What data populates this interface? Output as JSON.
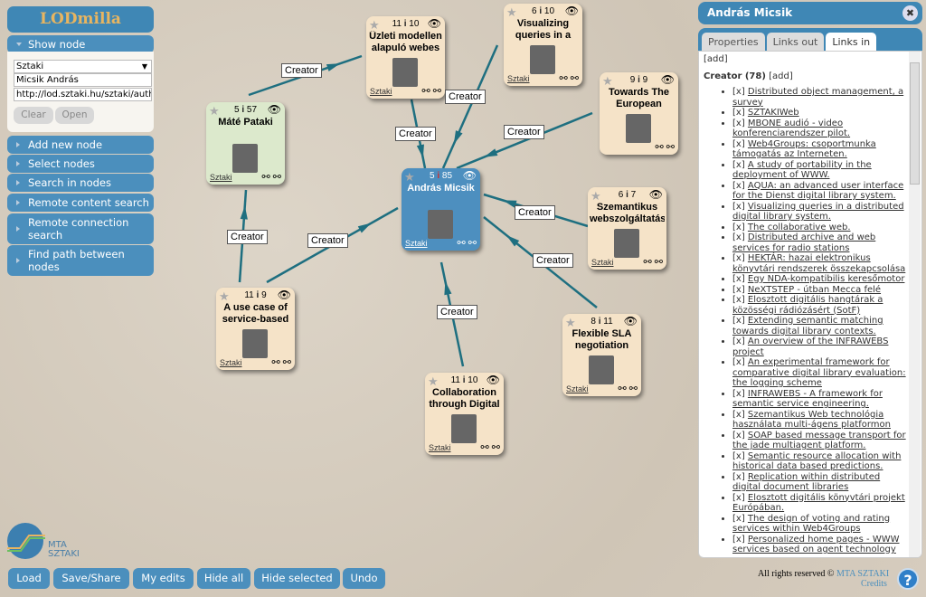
{
  "app": {
    "title": "LODmilla",
    "logo_text": "MTA SZTAKI"
  },
  "sidebar": {
    "show_node": {
      "label": "Show node",
      "source": "Sztaki",
      "name_value": "Micsik András",
      "uri_value": "http://lod.sztaki.hu/sztaki/auth",
      "clear": "Clear",
      "open": "Open"
    },
    "items": [
      "Add new node",
      "Select nodes",
      "Search in nodes",
      "Remote content search",
      "Remote connection search",
      "Find path between nodes"
    ]
  },
  "graph": {
    "edge_label": "Creator",
    "nodes": [
      {
        "title": "Üzleti modellen alapuló webes ..",
        "in": "11",
        "out": "10",
        "source": "Sztaki"
      },
      {
        "title": "Visualizing queries in a",
        "in": "6",
        "out": "10",
        "source": "Sztaki"
      },
      {
        "title": "Towards The European",
        "in": "9",
        "out": "9",
        "source": ""
      },
      {
        "title": "Máté Pataki",
        "in": "5",
        "out": "57",
        "source": "Sztaki"
      },
      {
        "title": "András Micsik",
        "in": "5",
        "out": "85",
        "source": "Sztaki"
      },
      {
        "title": "Szemantikus webszolgáltatás",
        "in": "6",
        "out": "7",
        "source": "Sztaki"
      },
      {
        "title": "A use case of service-based",
        "in": "11",
        "out": "9",
        "source": "Sztaki"
      },
      {
        "title": "Flexible SLA negotiation",
        "in": "8",
        "out": "11",
        "source": "Sztaki"
      },
      {
        "title": "Collaboration through Digital ..",
        "in": "11",
        "out": "10",
        "source": "Sztaki"
      }
    ]
  },
  "detail": {
    "title": "András Micsik",
    "tabs": [
      "Properties",
      "Links out",
      "Links in"
    ],
    "active_tab": "Links in",
    "add": "[add]",
    "group": "Creator (78)",
    "remove": "[x]",
    "links": [
      "Distributed object management, a survey",
      "SZTAKIWeb",
      "MBONE audió - video konferenciarendszer pilot.",
      "Web4Groups: csoportmunka támogatás az Interneten.",
      "A study of portability in the deployment of WWW.",
      "AQUA: an advanced user interface for the Dienst digital library system.",
      "Visualizing queries in a distributed digital library system.",
      "The collaborative web.",
      "Distributed archive and web services for radio stations",
      "HEKTÁR: hazai elektronikus könyvtári rendszerek összekapcsolása",
      "Egy NDA-kompatibilis keresőmotor",
      "NeXTSTEP - útban Mecca felé",
      "Elosztott digitális hangtárak a közösségi rádiózásért (SotF)",
      "Extending semantic matching towards digital library contexts.",
      "An overview of the INFRAWEBS project",
      "An experimental framework for comparative digital library evaluation: the logging scheme",
      "INFRAWEBS - A framework for semantic service engineering.",
      "Szemantikus Web technológia használata multi-ágens platformon",
      "SOAP based message transport for the jade multiagent platform.",
      "Semantic resource allocation with historical data based predictions.",
      "Replication within distributed digital document libraries",
      "Elosztott digitális könyvtári projekt Európában.",
      "The design of voting and rating services within Web4Groups",
      "Personalized home pages - WWW services based on agent technology"
    ]
  },
  "toolbar": [
    "Load",
    "Save/Share",
    "My edits",
    "Hide all",
    "Hide selected",
    "Undo"
  ],
  "footer": {
    "rights": "All rights reserved ©",
    "org": "MTA SZTAKI",
    "credits": "Credits",
    "help": "?"
  },
  "colors": {
    "accent": "#4b8fbd",
    "node": "#f5e3c8",
    "selected_node": "#4d8fbf",
    "edge": "#1e6f80"
  }
}
